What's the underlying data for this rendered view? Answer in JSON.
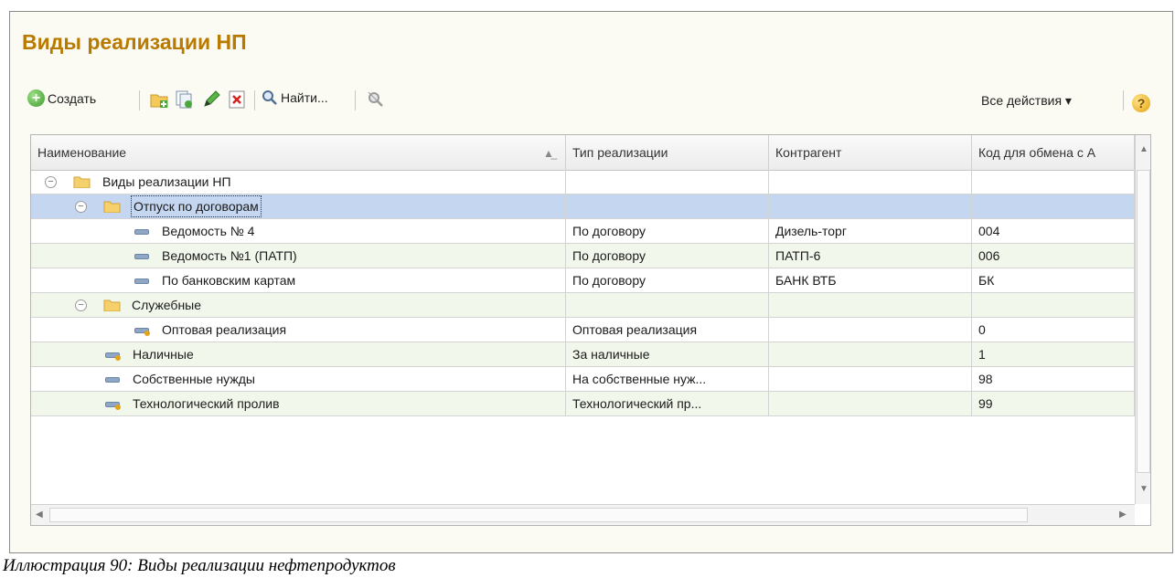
{
  "window": {
    "title": "Виды реализации НП"
  },
  "toolbar": {
    "create_label": "Создать",
    "find_label": "Найти...",
    "all_actions_label": "Все действия ▾",
    "help_label": "?"
  },
  "table": {
    "headers": [
      "Наименование",
      "Тип реализации",
      "Контрагент",
      "Код для обмена с А"
    ],
    "rows": [
      {
        "name": "Виды реализации НП",
        "type": "",
        "counterparty": "",
        "code": ""
      },
      {
        "name": "Отпуск по договорам",
        "type": "",
        "counterparty": "",
        "code": ""
      },
      {
        "name": "Ведомость № 4",
        "type": "По договору",
        "counterparty": "Дизель-торг",
        "code": "004"
      },
      {
        "name": "Ведомость №1 (ПАТП)",
        "type": "По договору",
        "counterparty": "ПАТП-6",
        "code": "006"
      },
      {
        "name": "По банковским картам",
        "type": "По договору",
        "counterparty": "БАНК ВТБ",
        "code": "БК"
      },
      {
        "name": "Служебные",
        "type": "",
        "counterparty": "",
        "code": ""
      },
      {
        "name": "Оптовая реализация",
        "type": "Оптовая реализация",
        "counterparty": "",
        "code": "0"
      },
      {
        "name": "Наличные",
        "type": "За наличные",
        "counterparty": "",
        "code": "1"
      },
      {
        "name": "Собственные нужды",
        "type": "На собственные нуж...",
        "counterparty": "",
        "code": "98"
      },
      {
        "name": "Технологический пролив",
        "type": "Технологический пр...",
        "counterparty": "",
        "code": "99"
      }
    ]
  },
  "caption": "Иллюстрация 90: Виды реализации нефтепродуктов",
  "colors": {
    "title": "#b97a00",
    "selected_row": "#c5d6f0",
    "alt_row": "#f2f7ec"
  }
}
